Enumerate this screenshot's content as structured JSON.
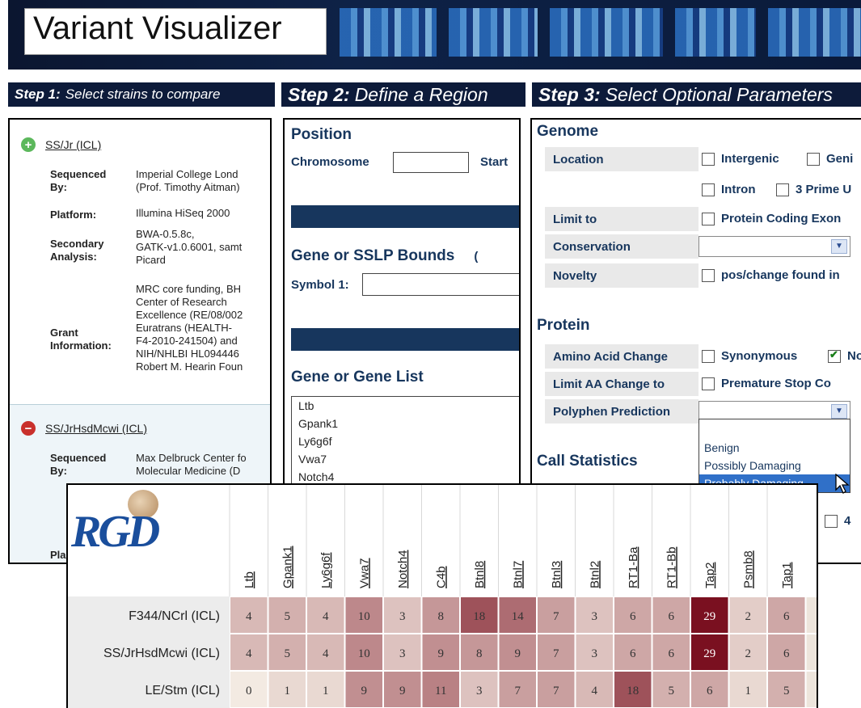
{
  "app": {
    "title": "Variant Visualizer"
  },
  "steps": [
    {
      "num": "Step 1:",
      "text": "Select strains to compare"
    },
    {
      "num": "Step 2:",
      "text": "Define a Region"
    },
    {
      "num": "Step 3:",
      "text": "Select Optional Parameters"
    }
  ],
  "strains": [
    {
      "name": "SS/Jr (ICL)",
      "status": "add",
      "fields": [
        {
          "label": "Sequenced\nBy:",
          "value": "Imperial College Lond\n(Prof. Timothy Aitman)"
        },
        {
          "label": "Platform:",
          "value": "Illumina HiSeq 2000"
        },
        {
          "label": "Secondary\nAnalysis:",
          "value": "BWA-0.5.8c,\nGATK-v1.0.6001, samt\nPicard"
        },
        {
          "label": "Grant\nInformation:",
          "value": "MRC core funding, BH\nCenter of Research\nExcellence (RE/08/002\nEuratrans (HEALTH-\nF4-2010-241504) and\nNIH/NHLBI HL094446\nRobert M. Hearin Foun"
        }
      ]
    },
    {
      "name": "SS/JrHsdMcwi (ICL)",
      "status": "remove",
      "fields": [
        {
          "label": "Sequenced\nBy:",
          "value": "Max Delbruck Center fo\nMolecular Medicine (D"
        },
        {
          "label": "Pla",
          "value": ""
        }
      ]
    }
  ],
  "region": {
    "position_title": "Position",
    "chromosome_label": "Chromosome",
    "start_label": "Start",
    "bounds_title": "Gene or SSLP Bounds",
    "bounds_suffix": "(",
    "symbol1_label": "Symbol 1:",
    "gene_list_title": "Gene or Gene List",
    "gene_list": [
      "Ltb",
      "Gpank1",
      "Ly6g6f",
      "Vwa7",
      "Notch4"
    ]
  },
  "params": {
    "genome_title": "Genome",
    "location_label": "Location",
    "location_opts": [
      "Intergenic",
      "Geni",
      "Intron",
      "3 Prime U"
    ],
    "limit_label": "Limit to",
    "limit_opt": "Protein Coding Exon",
    "conservation_label": "Conservation",
    "novelty_label": "Novelty",
    "novelty_opt": "pos/change found in",
    "protein_title": "Protein",
    "aa_label": "Amino Acid Change",
    "aa_opts": [
      "Synonymous",
      "No"
    ],
    "limit_aa_label": "Limit AA Change to",
    "limit_aa_opt": "Premature Stop Co",
    "polyphen_label": "Polyphen Prediction",
    "polyphen_options": [
      "Benign",
      "Possibly Damaging",
      "Probably Damaging"
    ],
    "polyphen_highlighted": "Probably Damaging",
    "call_stats_title": "Call Statistics",
    "tail_text": "4"
  },
  "colors": {
    "navy": "#0d1b3a",
    "heading": "#17365d",
    "heat_max": "#7a1020",
    "heat_min": "#f3ece4"
  },
  "chart_data": {
    "type": "heatmap",
    "categories": [
      "Ltb",
      "Gpank1",
      "Ly6g6f",
      "Vwa7",
      "Notch4",
      "C4b",
      "Btnl8",
      "Btnl7",
      "Btnl3",
      "Btnl2",
      "RT1-Ba",
      "RT1-Bb",
      "Tap2",
      "Psmb8",
      "Tap1"
    ],
    "series": [
      {
        "name": "F344/NCrl (ICL)",
        "values": [
          4,
          5,
          4,
          10,
          3,
          8,
          18,
          14,
          7,
          3,
          6,
          6,
          29,
          2,
          6
        ]
      },
      {
        "name": "SS/JrHsdMcwi (ICL)",
        "values": [
          4,
          5,
          4,
          10,
          3,
          9,
          8,
          9,
          7,
          3,
          6,
          6,
          29,
          2,
          6
        ]
      },
      {
        "name": "LE/Stm (ICL)",
        "values": [
          0,
          1,
          1,
          9,
          9,
          11,
          3,
          7,
          7,
          4,
          18,
          5,
          6,
          1,
          5
        ]
      }
    ]
  }
}
